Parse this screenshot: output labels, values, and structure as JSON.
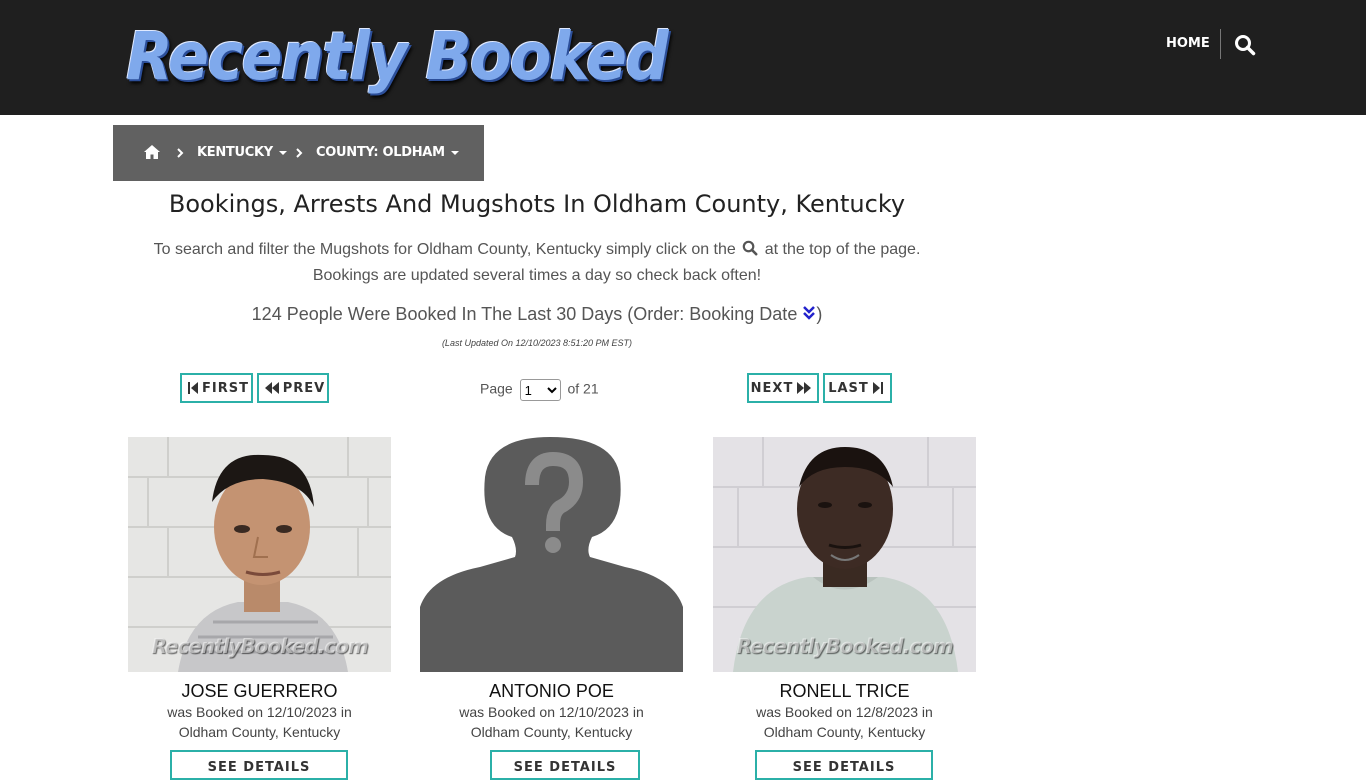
{
  "header": {
    "logo_text": "Recently Booked",
    "nav_home": "HOME",
    "search_icon": "search-icon"
  },
  "breadcrumb": {
    "home_icon": "home-icon",
    "state": "KENTUCKY",
    "county": "COUNTY: OLDHAM"
  },
  "main": {
    "title": "Bookings, Arrests And Mugshots In Oldham County, Kentucky",
    "intro_before_icon": "To search and filter the Mugshots for Oldham County, Kentucky simply click on the",
    "intro_after_icon": "at the top of the page.",
    "intro_line2": "Bookings are updated several times a day so check back often!",
    "count_text": "124 People Were Booked In The Last 30 Days (Order: Booking Date ",
    "count_close": ")",
    "last_updated": "(Last Updated On 12/10/2023 8:51:20 PM EST)"
  },
  "pagination": {
    "first": "FIRST",
    "prev": "PREV",
    "next": "NEXT",
    "last": "LAST",
    "page_label": "Page",
    "current_page": "1",
    "of_label": "of 21"
  },
  "bookings": [
    {
      "name": "JOSE GUERRERO",
      "booked_line": "was Booked on 12/10/2023 in",
      "location": "Oldham County, Kentucky",
      "button": "SEE DETAILS",
      "watermark": "RecentlyBooked.com"
    },
    {
      "name": "ANTONIO POE",
      "booked_line": "was Booked on 12/10/2023 in",
      "location": "Oldham County, Kentucky",
      "button": "SEE DETAILS"
    },
    {
      "name": "RONELL TRICE",
      "booked_line": "was Booked on 12/8/2023 in",
      "location": "Oldham County, Kentucky",
      "button": "SEE DETAILS",
      "watermark": "RecentlyBooked.com"
    }
  ],
  "colors": {
    "header_bg": "#1f1f1f",
    "breadcrumb_bg": "#616161",
    "button_border": "#2bb0a8",
    "sort_icon": "#2222cc"
  }
}
